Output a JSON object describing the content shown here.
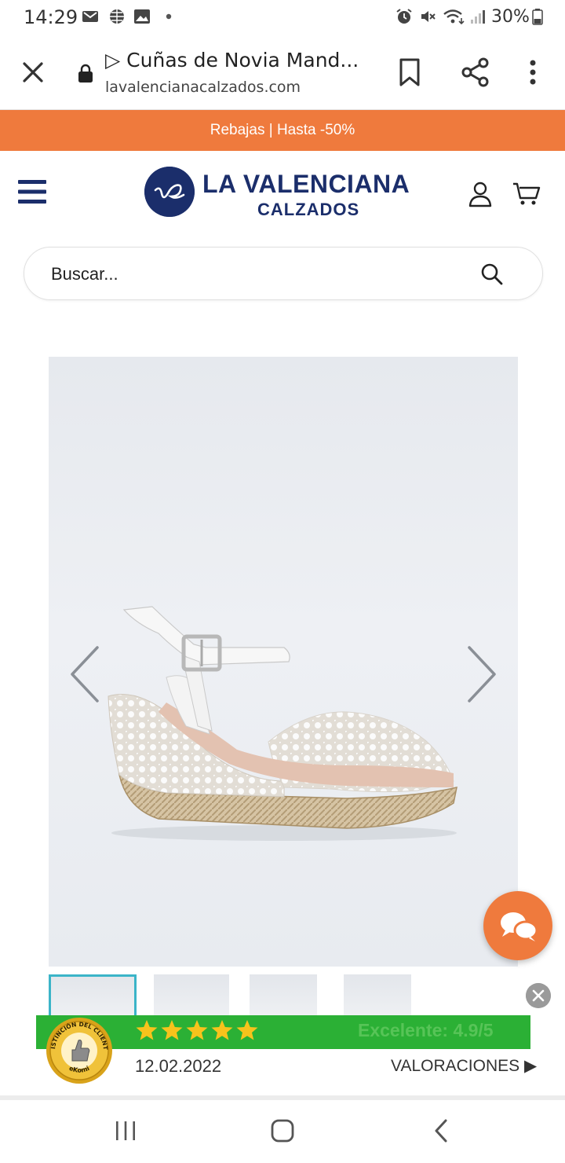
{
  "status_bar": {
    "time": "14:29",
    "battery": "30%",
    "left_icons": [
      "gmail-icon",
      "globe-icon",
      "gallery-icon",
      "dot-icon"
    ],
    "right_icons": [
      "alarm-icon",
      "mute-icon",
      "wifi-icon",
      "signal-icon",
      "battery-icon"
    ]
  },
  "browser": {
    "title": "▷ Cuñas de Novia Mand...",
    "url": "lavalencianacalzados.com"
  },
  "promo": {
    "text": "Rebajas | Hasta -50%",
    "color": "#ef7a3d"
  },
  "header": {
    "brand_line1": "LA VALENCIANA",
    "brand_line2": "CALZADOS",
    "brand_color": "#1b2e6b"
  },
  "search": {
    "placeholder": "Buscar..."
  },
  "gallery": {
    "thumbnail_count": 4,
    "selected_thumbnail": 1,
    "accent": "#3bb4c8"
  },
  "ekomi": {
    "rating_text": "Excelente: 4.9/5",
    "stars": 5,
    "date": "12.02.2022",
    "reviews_label": "VALORACIONES",
    "seal_top_text": "DISTINCIÓN DEL CLIENTE",
    "seal_bottom_text": "eKomi",
    "color": "#2bb035"
  }
}
